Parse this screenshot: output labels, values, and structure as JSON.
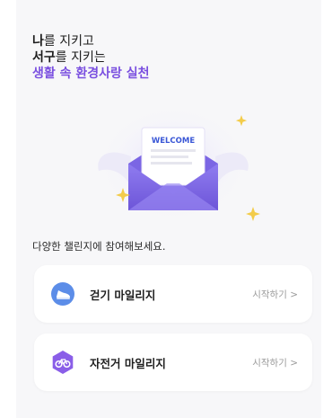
{
  "header": {
    "line1_bold": "나",
    "line1_rest": "를 지키고",
    "line2_bold": "서구",
    "line2_rest": "를 지키는",
    "line3": "생활 속 환경사랑 실천"
  },
  "hero": {
    "letter_text": "WELCOME",
    "icon": "winged-envelope-icon"
  },
  "intro_text": "다양한 챌린지에 참여해보세요.",
  "challenges": [
    {
      "title": "걷기 마일리지",
      "action": "시작하기 >",
      "icon": "sneaker-icon"
    },
    {
      "title": "자전거 마일리지",
      "action": "시작하기 >",
      "icon": "bicycle-icon"
    }
  ],
  "colors": {
    "accent": "#7a4fe0",
    "walk": "#5c8de8",
    "bike": "#8a5ee8"
  }
}
